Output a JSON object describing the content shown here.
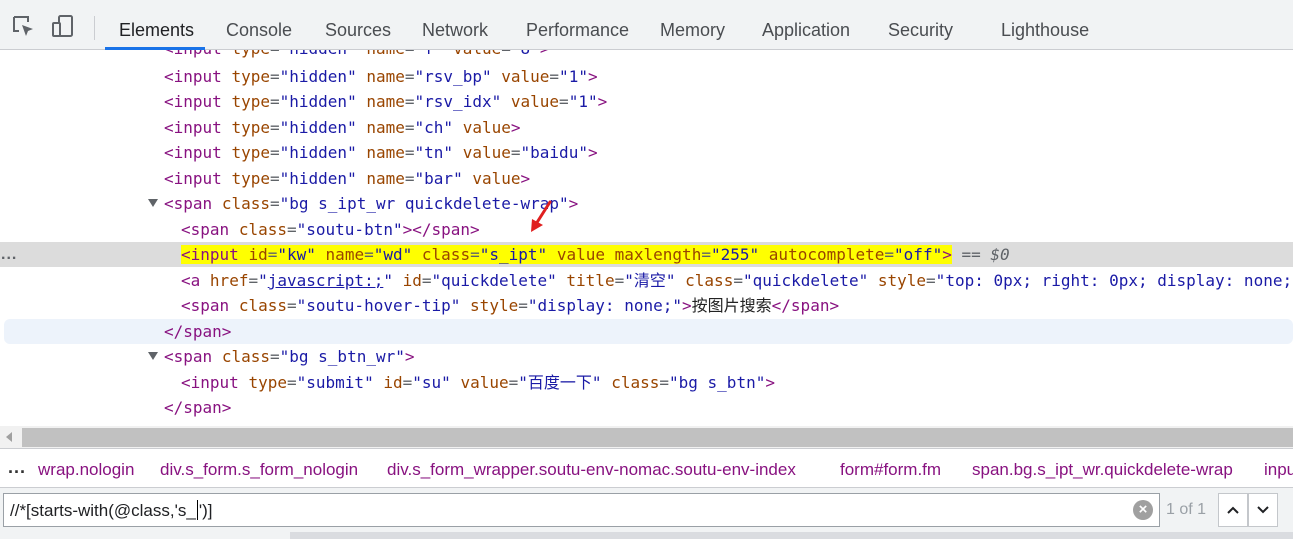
{
  "toolbar": {
    "icons": [
      "inspect-element-icon",
      "device-toolbar-icon"
    ],
    "tabs": [
      {
        "label": "Elements",
        "active": true
      },
      {
        "label": "Console"
      },
      {
        "label": "Sources"
      },
      {
        "label": "Network"
      },
      {
        "label": "Performance"
      },
      {
        "label": "Memory"
      },
      {
        "label": "Application"
      },
      {
        "label": "Security"
      },
      {
        "label": "Lighthouse"
      }
    ],
    "accent_color": "#1a73e8"
  },
  "dom": {
    "l0": {
      "open": "<",
      "tag": "input",
      "a1n": "type",
      "a1v": "hidden",
      "a2n": "name",
      "a2v": "f",
      "a3n": "value",
      "a3v": "8",
      "close": ">"
    },
    "l1": {
      "open": "<",
      "tag": "input",
      "a1n": "type",
      "a1v": "hidden",
      "a2n": "name",
      "a2v": "rsv_bp",
      "a3n": "value",
      "a3v": "1",
      "close": ">"
    },
    "l2": {
      "open": "<",
      "tag": "input",
      "a1n": "type",
      "a1v": "hidden",
      "a2n": "name",
      "a2v": "rsv_idx",
      "a3n": "value",
      "a3v": "1",
      "close": ">"
    },
    "l3": {
      "open": "<",
      "tag": "input",
      "a1n": "type",
      "a1v": "hidden",
      "a2n": "name",
      "a2v": "ch",
      "a3n": "value",
      "close": ">"
    },
    "l4": {
      "open": "<",
      "tag": "input",
      "a1n": "type",
      "a1v": "hidden",
      "a2n": "name",
      "a2v": "tn",
      "a3n": "value",
      "a3v": "baidu",
      "close": ">"
    },
    "l5": {
      "open": "<",
      "tag": "input",
      "a1n": "type",
      "a1v": "hidden",
      "a2n": "name",
      "a2v": "bar",
      "a3n": "value",
      "close": ">"
    },
    "l6": {
      "open": "<",
      "tag": "span",
      "a1n": "class",
      "a1v": "bg s_ipt_wr quickdelete-wrap",
      "close": ">"
    },
    "l7": {
      "open": "<",
      "tag": "span",
      "a1n": "class",
      "a1v": "soutu-btn",
      "mid": "></",
      "endtag": "span",
      "close": ">"
    },
    "l8": {
      "open": "<",
      "tag": "input",
      "a1n": "id",
      "a1v": "kw",
      "a2n": "name",
      "a2v": "wd",
      "a3n": "class",
      "a3v": "s_ipt",
      "a4n": "value",
      "a5n": "maxlength",
      "a5v": "255",
      "a6n": "autocomplete",
      "a6v": "off",
      "close": ">",
      "marker": "== $0"
    },
    "l9": {
      "open": "<",
      "tag": "a",
      "a1n": "href",
      "a1v": "javascript:;",
      "a2n": "id",
      "a2v": "quickdelete",
      "a3n": "title",
      "a3v": "清空",
      "a4n": "class",
      "a4v": "quickdelete",
      "a5n": "style",
      "a5v": "top: 0px; right: 0px; display: none;"
    },
    "l10": {
      "open": "<",
      "tag": "span",
      "a1n": "class",
      "a1v": "soutu-hover-tip",
      "a2n": "style",
      "a2v": "display: none;",
      "text": "按图片搜索",
      "endopen": "</",
      "endtag": "span",
      "close": ">"
    },
    "l11": {
      "open": "</",
      "tag": "span",
      "close": ">"
    },
    "l12": {
      "open": "<",
      "tag": "span",
      "a1n": "class",
      "a1v": "bg s_btn_wr",
      "close": ">"
    },
    "l13": {
      "open": "<",
      "tag": "input",
      "a1n": "type",
      "a1v": "submit",
      "a2n": "id",
      "a2v": "su",
      "a3n": "value",
      "a3v": "百度一下",
      "a4n": "class",
      "a4v": "bg s_btn",
      "close": ">"
    },
    "l14": {
      "open": "</",
      "tag": "span",
      "close": ">"
    },
    "dots": "..."
  },
  "breadcrumbs": {
    "dots": "...",
    "items": [
      "wrap.nologin",
      "div.s_form.s_form_nologin",
      "div.s_form_wrapper.soutu-env-nomac.soutu-env-index",
      "form#form.fm",
      "span.bg.s_ipt_wr.quickdelete-wrap",
      "input#kw.s_ipt"
    ]
  },
  "search": {
    "query_before_caret": "//*[starts-with(@class,'s_",
    "query_after_caret": "')]",
    "clear_symbol": "×",
    "match_count": "1 of 1",
    "prev_icon": "chevron-up-icon",
    "next_icon": "chevron-down-icon"
  },
  "annotation": {
    "arrow_color": "#e02020"
  }
}
